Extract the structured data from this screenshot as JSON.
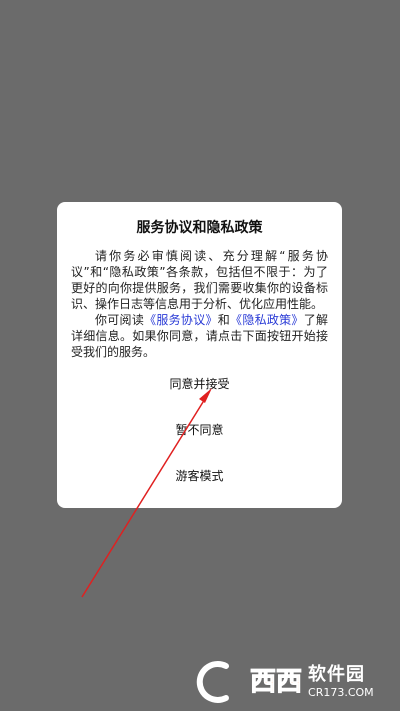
{
  "dialog": {
    "title": "服务协议和隐私政策",
    "para1": "请你务必审慎阅读、充分理解“服务协议”和“隐私政策”各条款，包括但不限于：为了更好的向你提供服务，我们需要收集你的设备标识、操作日志等信息用于分析、优化应用性能。",
    "para2_prefix": "你可阅读",
    "service_link": "《服务协议》",
    "para2_and": "和",
    "privacy_link": "《隐私政策》",
    "para2_suffix": "了解详细信息。如果你同意，请点击下面按钮开始接受我们的服务。",
    "agree_label": "同意并接受",
    "disagree_label": "暂不同意",
    "guest_label": "游客模式"
  },
  "annotation": {
    "arrow_color": "#e02020"
  },
  "watermark": {
    "logo_text": "西西",
    "name": "软件园",
    "domain": "CR173.COM"
  },
  "colors": {
    "overlay": "#6b6b6b",
    "link": "#2a3bd6"
  }
}
